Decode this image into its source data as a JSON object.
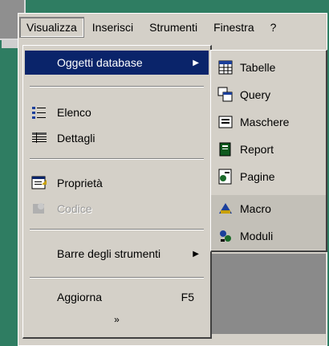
{
  "menubar": {
    "items": [
      {
        "label": "Visualizza"
      },
      {
        "label": "Inserisci"
      },
      {
        "label": "Strumenti"
      },
      {
        "label": "Finestra"
      },
      {
        "label": "?"
      }
    ]
  },
  "view_menu": {
    "items": [
      {
        "label": "Oggetti database",
        "icon": "submenu-arrow"
      },
      {
        "label": "Elenco",
        "icon": "list-icon"
      },
      {
        "label": "Dettagli",
        "icon": "details-icon"
      },
      {
        "label": "Proprietà",
        "icon": "properties-icon"
      },
      {
        "label": "Codice",
        "icon": "code-icon"
      },
      {
        "label": "Barre degli strumenti",
        "icon": "submenu-arrow"
      },
      {
        "label": "Aggiorna",
        "shortcut": "F5"
      }
    ],
    "more_glyph": "»"
  },
  "submenu": {
    "items": [
      {
        "label": "Tabelle",
        "icon": "table-icon"
      },
      {
        "label": "Query",
        "icon": "query-icon"
      },
      {
        "label": "Maschere",
        "icon": "form-icon"
      },
      {
        "label": "Report",
        "icon": "report-icon"
      },
      {
        "label": "Pagine",
        "icon": "page-icon"
      },
      {
        "label": "Macro",
        "icon": "macro-icon"
      },
      {
        "label": "Moduli",
        "icon": "module-icon"
      }
    ]
  },
  "colors": {
    "selection": "#0a246a",
    "menu_bg": "#d4d0c8",
    "background": "#2f7d62"
  }
}
